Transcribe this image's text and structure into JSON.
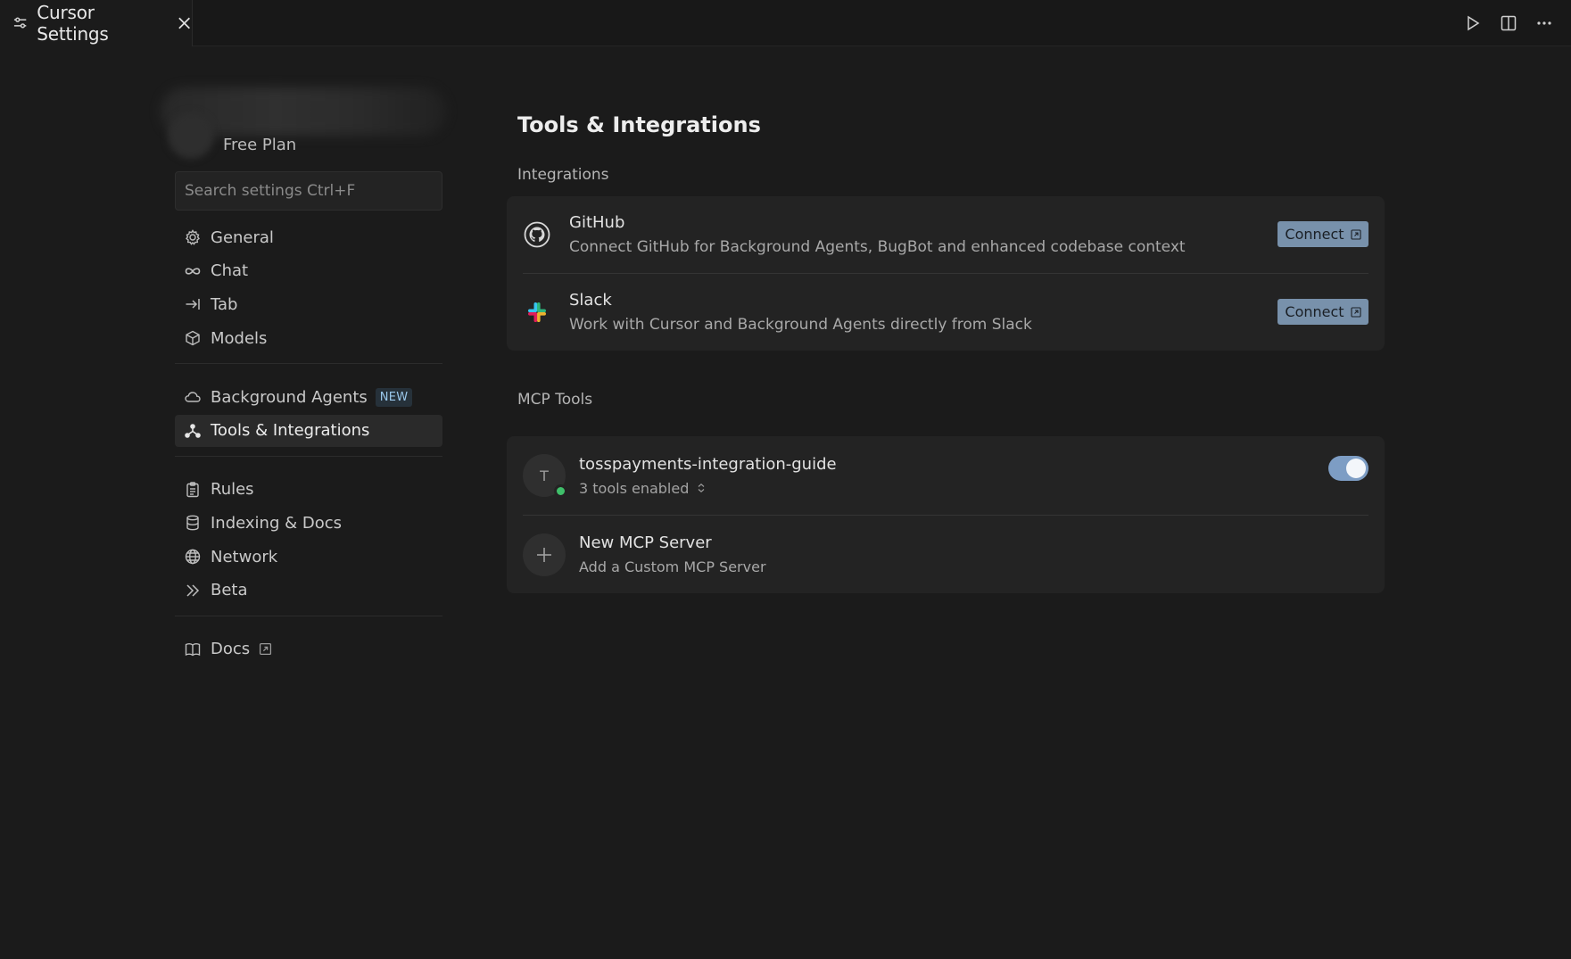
{
  "tab": {
    "title": "Cursor Settings"
  },
  "sidebar": {
    "plan": "Free Plan",
    "search_placeholder": "Search settings Ctrl+F",
    "groups": [
      [
        {
          "label": "General",
          "icon": "gear-icon"
        },
        {
          "label": "Chat",
          "icon": "infinity-icon"
        },
        {
          "label": "Tab",
          "icon": "tab-arrow-icon"
        },
        {
          "label": "Models",
          "icon": "cube-icon"
        }
      ],
      [
        {
          "label": "Background Agents",
          "icon": "cloud-icon",
          "badge": "NEW"
        },
        {
          "label": "Tools & Integrations",
          "icon": "nodes-icon",
          "active": true
        }
      ],
      [
        {
          "label": "Rules",
          "icon": "clipboard-icon"
        },
        {
          "label": "Indexing & Docs",
          "icon": "database-icon"
        },
        {
          "label": "Network",
          "icon": "globe-icon"
        },
        {
          "label": "Beta",
          "icon": "chevrons-right-icon"
        }
      ],
      [
        {
          "label": "Docs",
          "icon": "book-icon",
          "external": true
        }
      ]
    ]
  },
  "main": {
    "title": "Tools & Integrations",
    "integrations_label": "Integrations",
    "integrations": [
      {
        "name": "GitHub",
        "desc": "Connect GitHub for Background Agents, BugBot and enhanced codebase context",
        "button": "Connect",
        "icon": "github-icon"
      },
      {
        "name": "Slack",
        "desc": "Work with Cursor and Background Agents directly from Slack",
        "button": "Connect",
        "icon": "slack-icon"
      }
    ],
    "mcp_label": "MCP Tools",
    "mcp_servers": [
      {
        "initial": "T",
        "name": "tosspayments-integration-guide",
        "tools": "3 tools enabled",
        "enabled": true
      }
    ],
    "new_server": {
      "name": "New MCP Server",
      "desc": "Add a Custom MCP Server"
    }
  },
  "colors": {
    "background": "#1b1b1b",
    "card": "#232323",
    "button": "#7891ab",
    "toggle_on": "#7d9dc4",
    "status_dot": "#3fbf6a",
    "badge_text": "#9ac7ea"
  }
}
